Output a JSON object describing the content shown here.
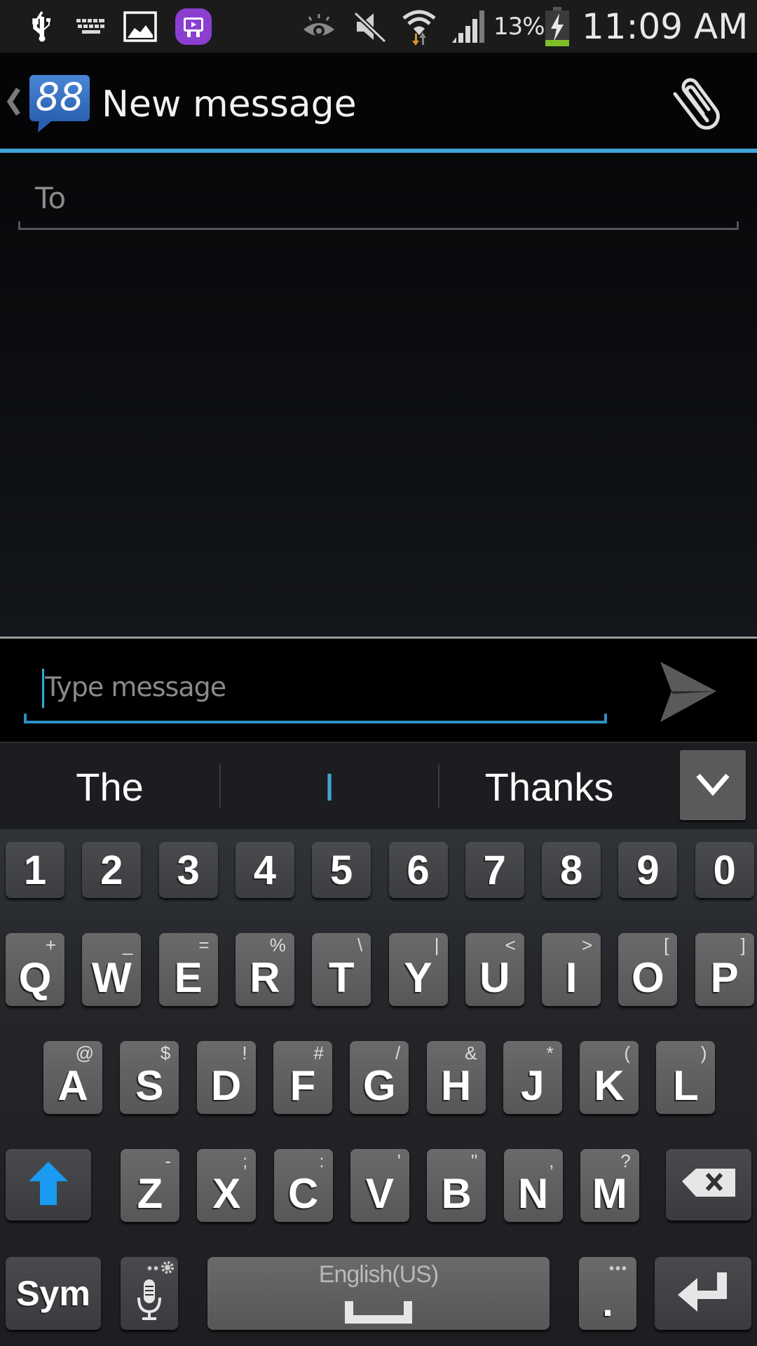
{
  "status_bar": {
    "left_icons": [
      "usb-icon",
      "keyboard-icon",
      "gallery-icon",
      "video-app-icon"
    ],
    "right_icons": [
      "smart-stay-eye-icon",
      "mute-icon",
      "wifi-icon",
      "signal-icon",
      "battery-charging-icon"
    ],
    "battery_percent": "13%",
    "time": "11:09 AM",
    "colors": {
      "video_app": "#8a3fd1",
      "battery_fill": "#7fbf2a",
      "wifi_down": "#e0952c"
    }
  },
  "action_bar": {
    "app_badge": "88",
    "title": "New message",
    "attach_icon": "paperclip-icon",
    "accent": "#3ea6d6"
  },
  "compose": {
    "to_placeholder": "To",
    "to_value": ""
  },
  "message_input": {
    "placeholder": "Type message",
    "value": "",
    "send_icon": "send-icon"
  },
  "suggestions": {
    "items": [
      "The",
      "I",
      "Thanks"
    ],
    "expand_icon": "chevron-down-icon"
  },
  "keyboard": {
    "number_row": [
      "1",
      "2",
      "3",
      "4",
      "5",
      "6",
      "7",
      "8",
      "9",
      "0"
    ],
    "row1": [
      {
        "key": "Q",
        "sub": "+"
      },
      {
        "key": "W",
        "sub": "_"
      },
      {
        "key": "E",
        "sub": "="
      },
      {
        "key": "R",
        "sub": "%"
      },
      {
        "key": "T",
        "sub": "\\"
      },
      {
        "key": "Y",
        "sub": "|"
      },
      {
        "key": "U",
        "sub": "<"
      },
      {
        "key": "I",
        "sub": ">"
      },
      {
        "key": "O",
        "sub": "["
      },
      {
        "key": "P",
        "sub": "]"
      }
    ],
    "row2": [
      {
        "key": "A",
        "sub": "@"
      },
      {
        "key": "S",
        "sub": "$"
      },
      {
        "key": "D",
        "sub": "!"
      },
      {
        "key": "F",
        "sub": "#"
      },
      {
        "key": "G",
        "sub": "/"
      },
      {
        "key": "H",
        "sub": "&"
      },
      {
        "key": "J",
        "sub": "*"
      },
      {
        "key": "K",
        "sub": "("
      },
      {
        "key": "L",
        "sub": ")"
      }
    ],
    "row3": [
      {
        "key": "Z",
        "sub": "-"
      },
      {
        "key": "X",
        "sub": ";"
      },
      {
        "key": "C",
        "sub": ":"
      },
      {
        "key": "V",
        "sub": "'"
      },
      {
        "key": "B",
        "sub": "\""
      },
      {
        "key": "N",
        "sub": ","
      },
      {
        "key": "M",
        "sub": "?"
      }
    ],
    "shift_icon": "shift-arrow-icon",
    "backspace_icon": "backspace-icon",
    "sym_label": "Sym",
    "mic_icon": "microphone-icon",
    "space_label": "English(US)",
    "period_label": ".",
    "enter_icon": "enter-icon",
    "shift_color": "#1a9af0"
  }
}
